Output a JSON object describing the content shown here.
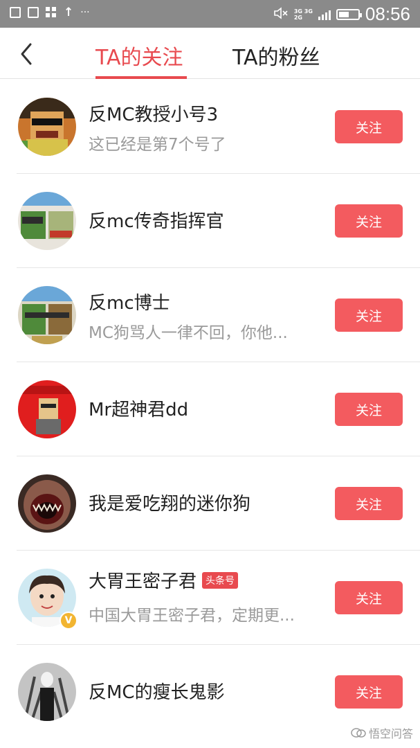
{
  "status_bar": {
    "icons": [
      "image-icon",
      "mail-icon",
      "grid-icon",
      "upload-arrow-icon",
      "more-dots-icon"
    ],
    "arrow_glyph": "↑",
    "dots": "···",
    "network_top": "3G 3G",
    "network_bottom": "2G",
    "time": "08:56"
  },
  "header": {
    "tabs": [
      {
        "label": "TA的关注",
        "active": true
      },
      {
        "label": "TA的粉丝",
        "active": false
      }
    ],
    "accent_color": "#e84a4f"
  },
  "list": [
    {
      "name": "反MC教授小号3",
      "desc": "这已经是第7个号了",
      "button": "关注"
    },
    {
      "name": "反mc传奇指挥官",
      "desc": "",
      "button": "关注"
    },
    {
      "name": "反mc博士",
      "desc": "MC狗骂人一律不回，你他...",
      "button": "关注"
    },
    {
      "name": "Mr超神君dd",
      "desc": "",
      "button": "关注"
    },
    {
      "name": "我是爱吃翔的迷你狗",
      "desc": "",
      "button": "关注"
    },
    {
      "name": "大胃王密子君",
      "badge": "头条号",
      "desc": "中国大胃王密子君，定期更...",
      "button": "关注"
    },
    {
      "name": "反MC的瘦长鬼影",
      "desc": "",
      "button": "关注"
    }
  ],
  "watermark": "悟空问答",
  "button_color": "#f35b5f"
}
